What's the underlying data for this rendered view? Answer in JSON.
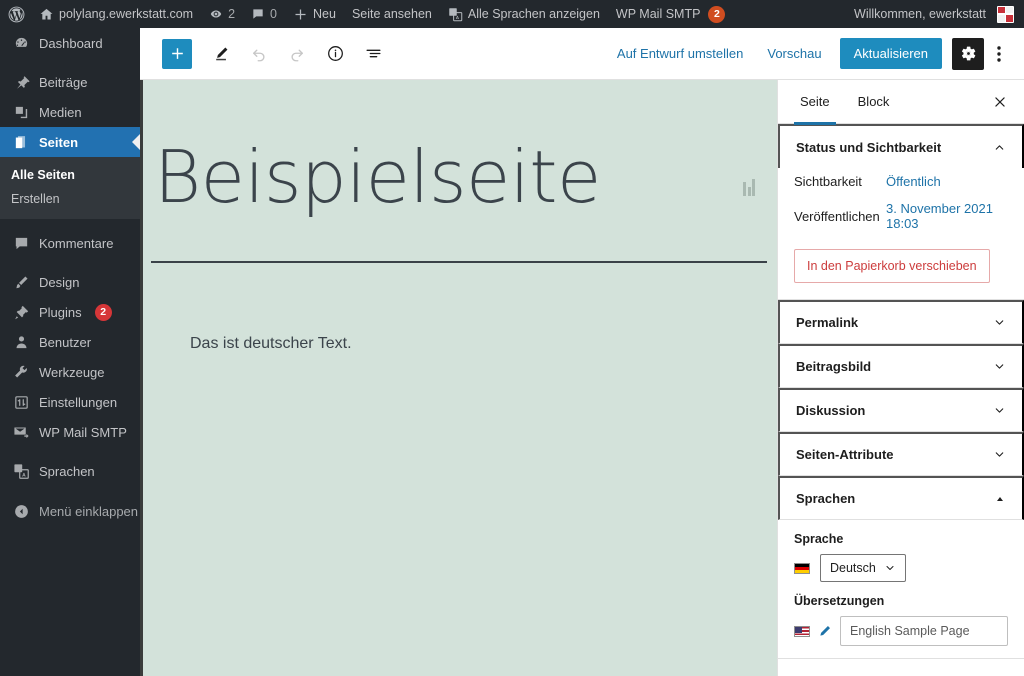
{
  "colors": {
    "admin_dark": "#23282d",
    "admin_submenu": "#32373c",
    "accent_blue": "#1e8cbe",
    "link_blue": "#1e73a8",
    "badge_red": "#d63638",
    "badge_orange": "#d04d20",
    "canvas_green": "#d3e2da",
    "trash_red": "#cc3c3c"
  },
  "adminbar": {
    "logo_icon": "wordpress-logo-icon",
    "home_icon": "home-icon",
    "site_name": "polylang.ewerkstatt.com",
    "updates_icon": "updates-icon",
    "updates_count": "2",
    "comments_icon": "comment-bubble-icon",
    "comments_count": "0",
    "new_icon": "plus-icon",
    "new_label": "Neu",
    "view_page_label": "Seite ansehen",
    "languages_icon": "translate-icon",
    "languages_label": "Alle Sprachen anzeigen",
    "smtp_label": "WP Mail SMTP",
    "smtp_badge": "2",
    "howdy_label": "Willkommen, ewerkstatt",
    "avatar_name": "user-avatar"
  },
  "sidebar": {
    "items": [
      {
        "label": "Dashboard",
        "icon": "dashboard-icon",
        "name": "dashboard",
        "sep": false,
        "current": false
      },
      {
        "label": "Beiträge",
        "icon": "pin-icon",
        "name": "posts",
        "sep": true,
        "current": false
      },
      {
        "label": "Medien",
        "icon": "media-icon",
        "name": "media",
        "sep": false,
        "current": false
      },
      {
        "label": "Seiten",
        "icon": "pages-icon",
        "name": "pages",
        "sep": false,
        "current": true
      },
      {
        "label": "Kommentare",
        "icon": "comment-icon",
        "name": "comments",
        "sep": true,
        "current": false
      },
      {
        "label": "Design",
        "icon": "appearance-icon",
        "name": "appearance",
        "sep": true,
        "current": false
      },
      {
        "label": "Plugins",
        "icon": "plugins-icon",
        "name": "plugins",
        "sep": false,
        "current": false,
        "badge": "2"
      },
      {
        "label": "Benutzer",
        "icon": "users-icon",
        "name": "users",
        "sep": false,
        "current": false
      },
      {
        "label": "Werkzeuge",
        "icon": "tools-icon",
        "name": "tools",
        "sep": false,
        "current": false
      },
      {
        "label": "Einstellungen",
        "icon": "settings-icon",
        "name": "settings",
        "sep": false,
        "current": false
      },
      {
        "label": "WP Mail SMTP",
        "icon": "mail-icon",
        "name": "wp-mail-smtp",
        "sep": false,
        "current": false
      },
      {
        "label": "Sprachen",
        "icon": "translate-icon",
        "name": "languages",
        "sep": true,
        "current": false
      }
    ],
    "submenu": {
      "all_pages": "Alle Seiten",
      "add_new": "Erstellen"
    },
    "collapse_label": "Menü einklappen",
    "collapse_icon": "collapse-arrow-icon"
  },
  "toolbar": {
    "add_block_icon": "plus-icon",
    "edit_tool_icon": "pencil-icon",
    "undo_icon": "undo-icon",
    "redo_icon": "redo-icon",
    "info_icon": "info-circle-icon",
    "list_view_icon": "list-view-icon",
    "switch_to_draft": "Auf Entwurf umstellen",
    "preview": "Vorschau",
    "update": "Aktualisieren",
    "settings_gear_icon": "gear-icon",
    "more_menu_icon": "kebab-menu-icon"
  },
  "canvas": {
    "title": "Beispielseite",
    "body_text": "Das ist deutscher Text.",
    "drag_handle_icon": "drag-handle-icon"
  },
  "settings": {
    "tabs": [
      {
        "label": "Seite",
        "active": true
      },
      {
        "label": "Block",
        "active": false
      }
    ],
    "close_icon": "close-icon",
    "status_panel": {
      "title": "Status und Sichtbarkeit",
      "chevron": "chevron-up-icon",
      "visibility_label": "Sichtbarkeit",
      "visibility_value": "Öffentlich",
      "publish_label": "Veröffentlichen",
      "publish_value": "3. November 2021 18:03",
      "trash_label": "In den Papierkorb verschieben"
    },
    "panels": [
      {
        "label": "Permalink",
        "chevron": "chevron-down-icon",
        "name": "permalink"
      },
      {
        "label": "Beitragsbild",
        "chevron": "chevron-down-icon",
        "name": "featured-image"
      },
      {
        "label": "Diskussion",
        "chevron": "chevron-down-icon",
        "name": "discussion"
      },
      {
        "label": "Seiten-Attribute",
        "chevron": "chevron-down-icon",
        "name": "page-attributes"
      }
    ],
    "languages_panel": {
      "title": "Sprachen",
      "chevron": "chevron-up-icon",
      "language_label": "Sprache",
      "language_flag": "german-flag-icon",
      "language_value": "Deutsch",
      "select_chevron": "chevron-down-icon",
      "translations_label": "Übersetzungen",
      "translation_flag": "us-flag-icon",
      "translation_edit_icon": "pencil-icon",
      "translation_value": "English Sample Page"
    }
  }
}
